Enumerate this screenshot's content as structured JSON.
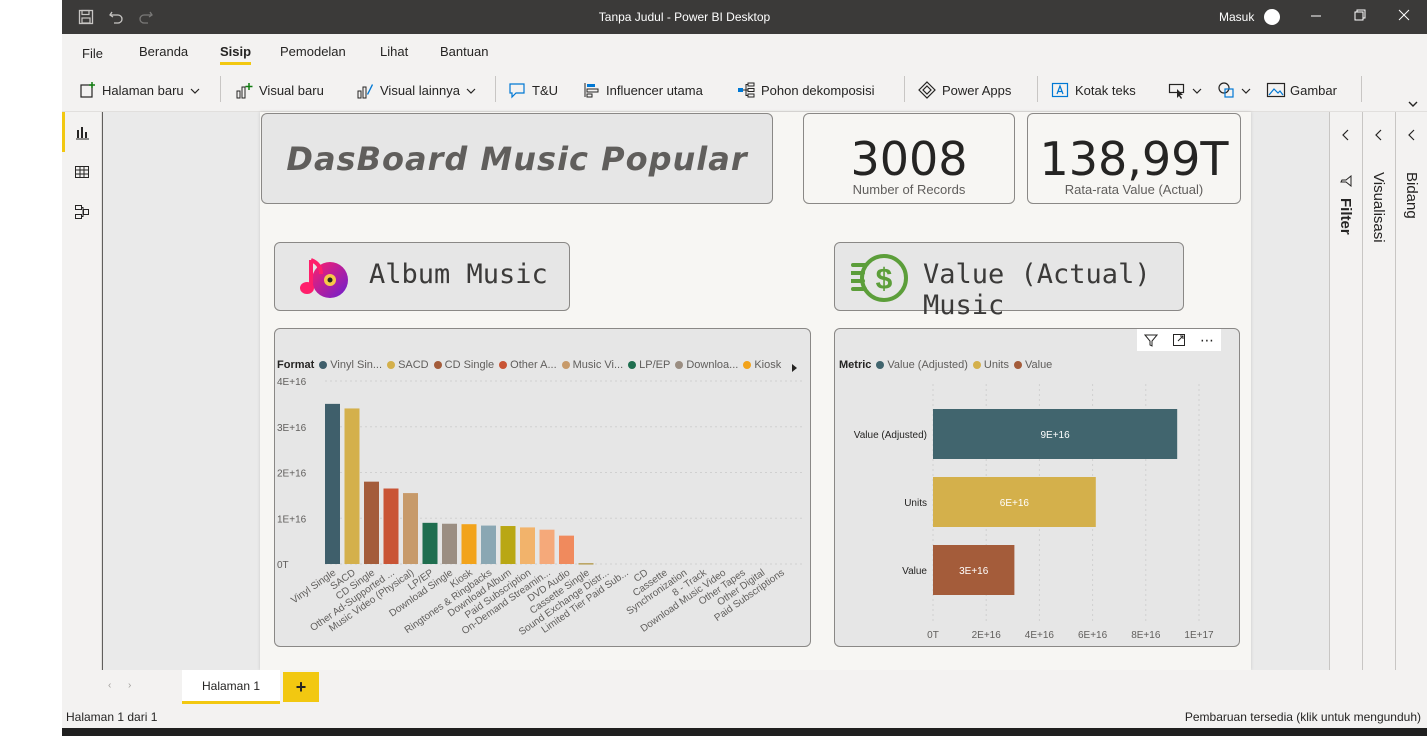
{
  "window": {
    "title": "Tanpa Judul - Power BI Desktop",
    "signin": "Masuk"
  },
  "menu": {
    "items": [
      "File",
      "Beranda",
      "Sisip",
      "Pemodelan",
      "Lihat",
      "Bantuan"
    ],
    "active": "Sisip"
  },
  "ribbon": {
    "new_page": "Halaman baru",
    "new_visual": "Visual baru",
    "more_visuals": "Visual lainnya",
    "qa": "T&U",
    "key_influencers": "Influencer utama",
    "decomposition_tree": "Pohon dekomposisi",
    "power_apps": "Power Apps",
    "text_box": "Kotak teks",
    "image": "Gambar"
  },
  "dashboard": {
    "title": "DasBoard Music Popular",
    "kpi1": {
      "value": "3008",
      "label": "Number of Records"
    },
    "kpi2": {
      "value": "138,99T",
      "label": "Rata-rata Value (Actual)"
    },
    "banner1": "Album Music",
    "banner2": "Value (Actual) Music"
  },
  "panes": {
    "filter": "Filter",
    "visualizations": "Visualisasi",
    "fields": "Bidang"
  },
  "page_tabs": {
    "tab1": "Halaman 1",
    "add": "+"
  },
  "status": {
    "page_info": "Halaman 1 dari 1",
    "update": "Pembaruan tersedia (klik untuk mengunduh)"
  },
  "colors": {
    "accent": "#f2c811",
    "titlebar": "#3b3a39"
  },
  "chart_data": [
    {
      "type": "bar",
      "legend_title": "Format",
      "legend_items": [
        {
          "label": "Vinyl Sin...",
          "color": "#3f5f6b"
        },
        {
          "label": "SACD",
          "color": "#d4b04b"
        },
        {
          "label": "CD Single",
          "color": "#a45c3a"
        },
        {
          "label": "Other A...",
          "color": "#c95435"
        },
        {
          "label": "Music Vi...",
          "color": "#c79a6a"
        },
        {
          "label": "LP/EP",
          "color": "#1f6e4f"
        },
        {
          "label": "Downloa...",
          "color": "#9b8e82"
        },
        {
          "label": "Kiosk",
          "color": "#f2a31b"
        }
      ],
      "categories": [
        "Vinyl Single",
        "SACD",
        "CD Single",
        "Other Ad-Supported ...",
        "Music Video (Physical)",
        "LP/EP",
        "Download Single",
        "Kiosk",
        "Ringtones & Ringbacks",
        "Download Album",
        "Paid Subscription",
        "On-Demand Streamin...",
        "DVD Audio",
        "Cassette Single",
        "Sound Exchange Distr...",
        "Limited Tier Paid Sub...",
        "CD",
        "Cassette",
        "Synchronization",
        "8 - Track",
        "Download Music Video",
        "Other Tapes",
        "Other Digital",
        "Paid Subscriptions"
      ],
      "values": [
        3.5e+16,
        3.4e+16,
        1.8e+16,
        1.65e+16,
        1.55e+16,
        9000000000000000.0,
        8800000000000000.0,
        8700000000000000.0,
        8400000000000000.0,
        8300000000000000.0,
        8000000000000000.0,
        7500000000000000.0,
        6200000000000000.0,
        200000000000000.0,
        0,
        0,
        0,
        0,
        0,
        0,
        0,
        0,
        0,
        0
      ],
      "colors": [
        "#3f5f6b",
        "#d4b04b",
        "#a45c3a",
        "#c95435",
        "#c79a6a",
        "#1f6e4f",
        "#9b8e82",
        "#f2a31b",
        "#8aa7b3",
        "#b9a714",
        "#f2b36b",
        "#f5a97a",
        "#f08a5d",
        "#b8a15a",
        "#2ca02c",
        "#cccccc",
        "#cccccc",
        "#cccccc",
        "#cccccc",
        "#cccccc",
        "#cccccc",
        "#cccccc",
        "#cccccc",
        "#cccccc"
      ],
      "yticks": [
        "0T",
        "1E+16",
        "2E+16",
        "3E+16",
        "4E+16"
      ],
      "ylim": [
        0,
        4e+16
      ]
    },
    {
      "type": "bar",
      "orientation": "horizontal",
      "legend_title": "Metric",
      "legend_items": [
        {
          "label": "Value (Adjusted)",
          "color": "#41656e"
        },
        {
          "label": "Units",
          "color": "#d4b04b"
        },
        {
          "label": "Value",
          "color": "#a45c3a"
        }
      ],
      "categories": [
        "Value (Adjusted)",
        "Units",
        "Value"
      ],
      "values": [
        9e+16,
        6e+16,
        3e+16
      ],
      "data_labels": [
        "9E+16",
        "6E+16",
        "3E+16"
      ],
      "colors": [
        "#41656e",
        "#d4b04b",
        "#a45c3a"
      ],
      "xticks": [
        "0T",
        "2E+16",
        "4E+16",
        "6E+16",
        "8E+16",
        "1E+17"
      ],
      "xlim": [
        0,
        1e+17
      ]
    }
  ]
}
